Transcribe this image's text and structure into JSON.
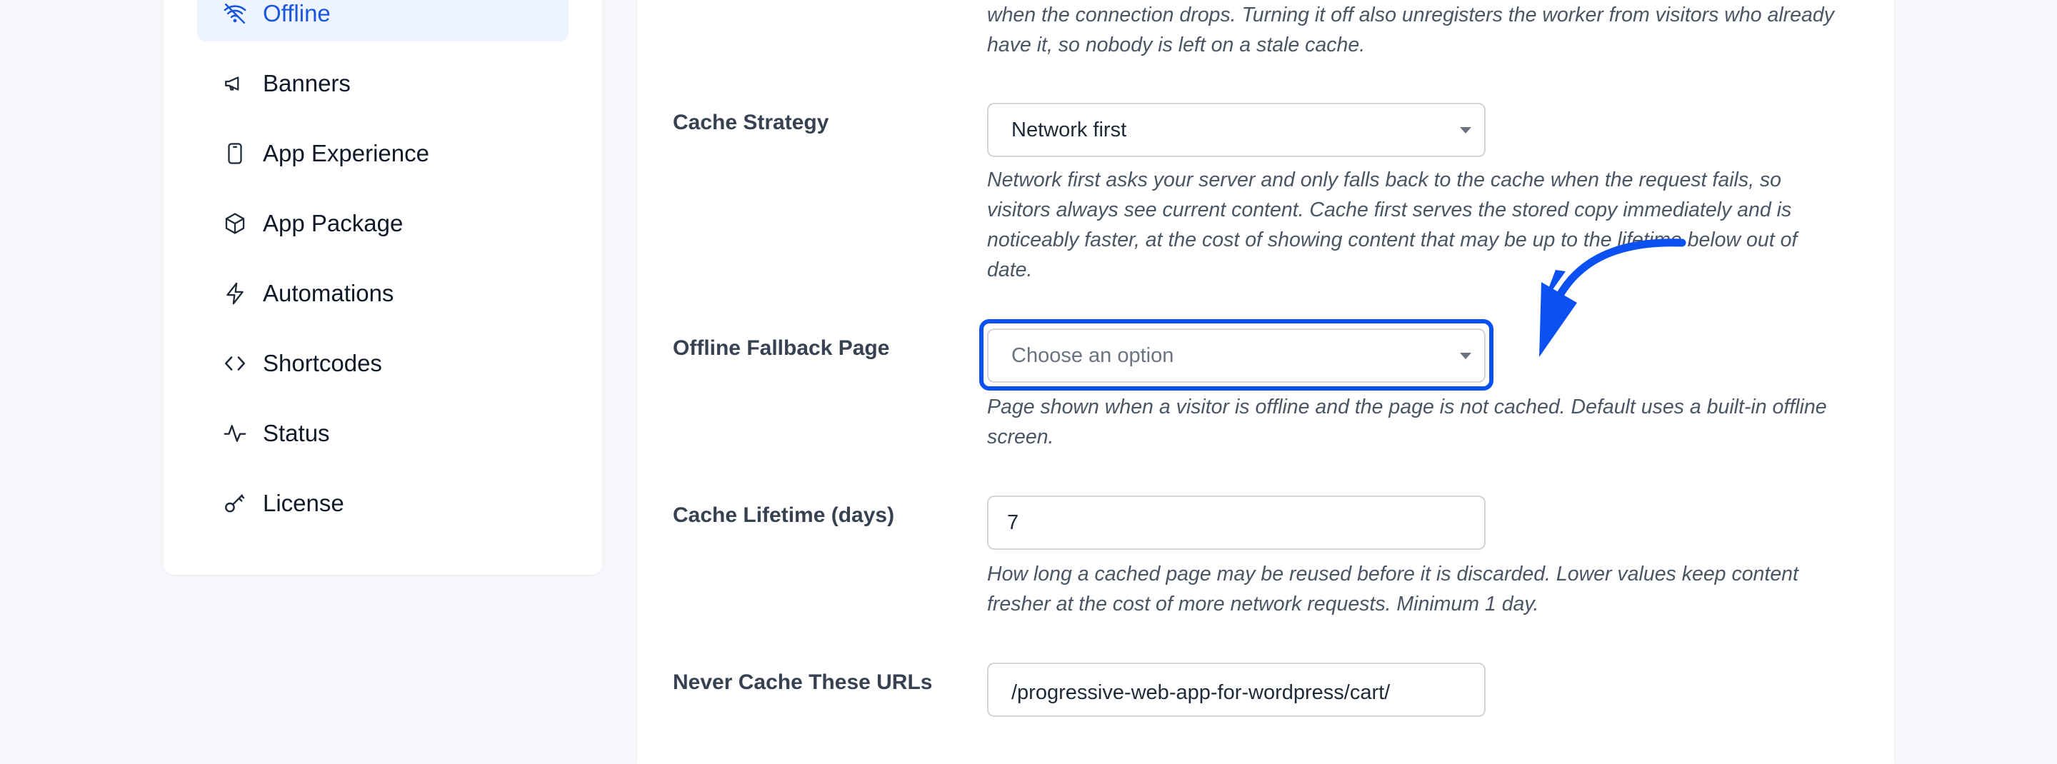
{
  "sidebar": {
    "items": [
      {
        "label": "Offline",
        "icon": "wifi-off-icon",
        "active": true
      },
      {
        "label": "Banners",
        "icon": "megaphone-icon"
      },
      {
        "label": "App Experience",
        "icon": "smartphone-icon"
      },
      {
        "label": "App Package",
        "icon": "package-icon"
      },
      {
        "label": "Automations",
        "icon": "bolt-icon"
      },
      {
        "label": "Shortcodes",
        "icon": "code-icon"
      },
      {
        "label": "Status",
        "icon": "activity-icon"
      },
      {
        "label": "License",
        "icon": "key-icon"
      }
    ]
  },
  "settings": {
    "top_description": "when the connection drops. Turning it off also unregisters the worker from visitors who already have it, so nobody is left on a stale cache.",
    "cache_strategy": {
      "label": "Cache Strategy",
      "value": "Network first",
      "description": "Network first asks your server and only falls back to the cache when the request fails, so visitors always see current content. Cache first serves the stored copy immediately and is noticeably faster, at the cost of showing content that may be up to the lifetime below out of date."
    },
    "offline_fallback": {
      "label": "Offline Fallback Page",
      "placeholder": "Choose an option",
      "description": "Page shown when a visitor is offline and the page is not cached. Default uses a built-in offline screen."
    },
    "cache_lifetime": {
      "label": "Cache Lifetime (days)",
      "value": "7",
      "description": "How long a cached page may be reused before it is discarded. Lower values keep content fresher at the cost of more network requests. Minimum 1 day."
    },
    "never_cache": {
      "label": "Never Cache These URLs",
      "value": "/progressive-web-app-for-wordpress/cart/"
    }
  },
  "colors": {
    "accent": "#1a56db",
    "highlight": "#0b50f0",
    "active_bg": "#eef4ff"
  }
}
